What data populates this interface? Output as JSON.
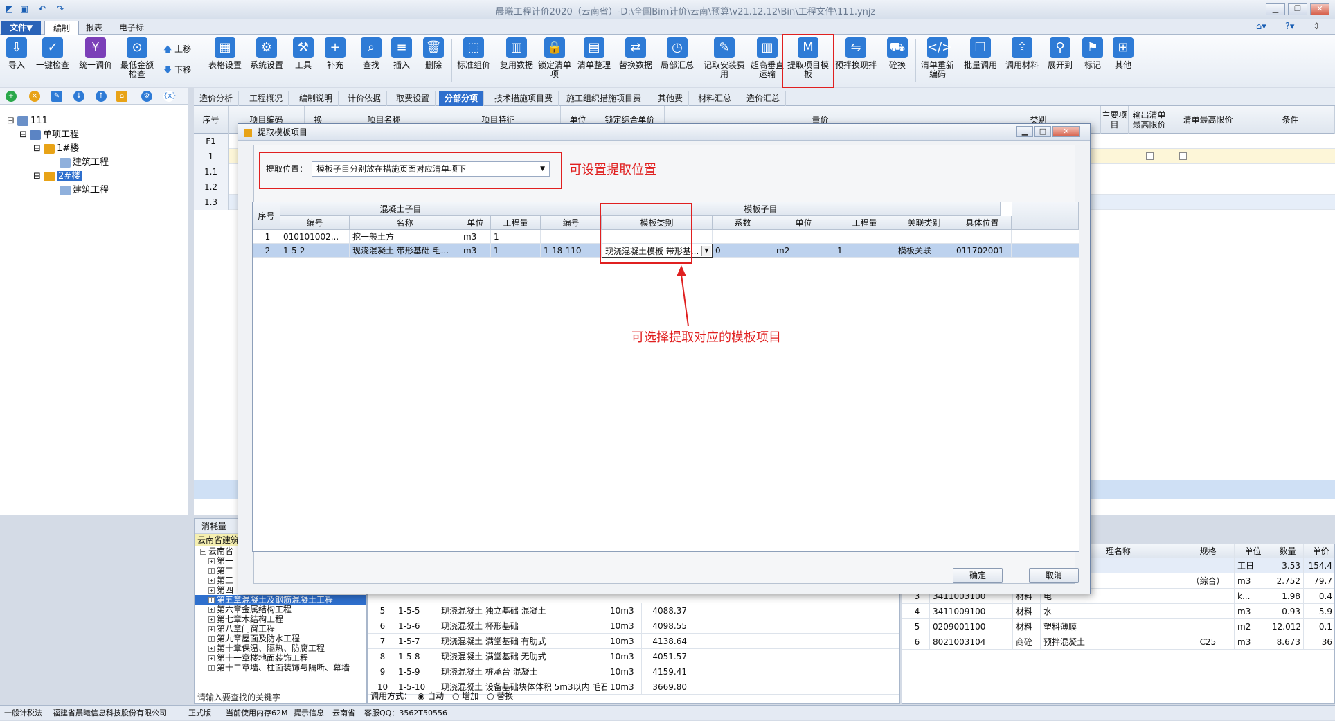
{
  "titlebar": {
    "title": "晨曦工程计价2020（云南省）-D:\\全国Bim计价\\云南\\预算\\v21.12.12\\Bin\\工程文件\\111.ynjz"
  },
  "menubar": {
    "file": "文件▼",
    "tabs": [
      "编制",
      "报表",
      "电子标"
    ]
  },
  "ribbon": {
    "buttons": [
      "导入",
      "一键检查",
      "统一调价",
      "最低金额检查",
      "上移",
      "下移",
      "表格设置",
      "系统设置",
      "工具",
      "补充",
      "查找",
      "插入",
      "删除",
      "标准组价",
      "复用数据",
      "锁定清单项",
      "清单整理",
      "替换数据",
      "局部汇总",
      "记取安装费用",
      "超高垂直运输",
      "提取项目模板",
      "预拌换现拌",
      "砼换",
      "清单重新编码",
      "批量调用",
      "调用材料",
      "展开到",
      "标记",
      "其他"
    ]
  },
  "tree": {
    "root": "111",
    "project": "单项工程",
    "b1": "1#楼",
    "b1c": "建筑工程",
    "b2": "2#楼",
    "b2c": "建筑工程"
  },
  "subtabs": [
    "造价分析",
    "工程概况",
    "编制说明",
    "计价依据",
    "取费设置",
    "分部分项",
    "技术措施项目费",
    "施工组织措施项目费",
    "其他费",
    "材料汇总",
    "造价汇总"
  ],
  "main_headers": [
    "序号",
    "项目编码",
    "换",
    "项目名称",
    "项目特征",
    "单位",
    "锁定综合单价",
    "量价",
    "类别",
    "主要项目",
    "输出清单最高限价",
    "清单最高限价",
    "条件"
  ],
  "main_rows": [
    "F1",
    "1",
    "1.1",
    "1.2",
    "1.3"
  ],
  "bottom_left": {
    "tab": "消耗量",
    "lib": "云南省建筑",
    "root": "云南省",
    "chapters": [
      "第一",
      "第二",
      "第三",
      "第四",
      "第五章混凝土及钢筋混凝土工程",
      "第六章金属结构工程",
      "第七章木结构工程",
      "第八章门窗工程",
      "第九章屋面及防水工程",
      "第十章保温、隔热、防腐工程",
      "第十一章楼地面装饰工程",
      "第十二章墙、柱面装饰与隔断、幕墙"
    ],
    "search_placeholder": "请输入要查找的关键字"
  },
  "bottom_mid": {
    "rows": [
      {
        "n": "5",
        "code": "1-5-5",
        "name": "现浇混凝土 独立基础 混凝土",
        "unit": "10m3",
        "price": "4088.37"
      },
      {
        "n": "6",
        "code": "1-5-6",
        "name": "现浇混凝土 杯形基础",
        "unit": "10m3",
        "price": "4098.55"
      },
      {
        "n": "7",
        "code": "1-5-7",
        "name": "现浇混凝土 满堂基础 有肋式",
        "unit": "10m3",
        "price": "4138.64"
      },
      {
        "n": "8",
        "code": "1-5-8",
        "name": "现浇混凝土 满堂基础 无肋式",
        "unit": "10m3",
        "price": "4051.57"
      },
      {
        "n": "9",
        "code": "1-5-9",
        "name": "现浇混凝土 桩承台 混凝土",
        "unit": "10m3",
        "price": "4159.41"
      },
      {
        "n": "10",
        "code": "1-5-10",
        "name": "现浇混凝土 设备基础块体体积 5m3以内 毛石混凝土",
        "unit": "10m3",
        "price": "3669.80"
      }
    ],
    "call_mode_label": "调用方式：",
    "modes": [
      "自动",
      "增加",
      "替换"
    ]
  },
  "bottom_right": {
    "headers": [
      "",
      "",
      "",
      "理名称",
      "规格",
      "单位",
      "数量",
      "单价"
    ],
    "rows": [
      {
        "n": "",
        "code": "",
        "type": "",
        "name": "2",
        "spec": "",
        "unit": "工日",
        "qty": "3.53",
        "price": "154.4"
      },
      {
        "n": "",
        "code": "",
        "type": "",
        "name": "",
        "spec": "（综合）",
        "unit": "m3",
        "qty": "2.752",
        "price": "79.7"
      },
      {
        "n": "3",
        "code": "3411003100",
        "type": "材料",
        "name": "电",
        "spec": "",
        "unit": "k...",
        "qty": "1.98",
        "price": "0.4"
      },
      {
        "n": "4",
        "code": "3411009100",
        "type": "材料",
        "name": "水",
        "spec": "",
        "unit": "m3",
        "qty": "0.93",
        "price": "5.9"
      },
      {
        "n": "5",
        "code": "0209001100",
        "type": "材料",
        "name": "塑料薄膜",
        "spec": "",
        "unit": "m2",
        "qty": "12.012",
        "price": "0.1"
      },
      {
        "n": "6",
        "code": "8021003104",
        "type": "商砼",
        "name": "预拌混凝土",
        "spec": "C25",
        "unit": "m3",
        "qty": "8.673",
        "price": "36"
      }
    ]
  },
  "status": {
    "items": [
      "一般计税法",
      "福建省晨曦信息科技股份有限公司",
      "正式版",
      "当前使用内存62M",
      "提示信息",
      "云南省",
      "客服QQ：3562T50556"
    ]
  },
  "dialog": {
    "title": "提取模板项目",
    "loc_label": "提取位置：",
    "loc_value": "模板子目分别放在措施页面对应清单项下",
    "ann_loc": "可设置提取位置",
    "ann_type": "可选择提取对应的模板项目",
    "group1": "混凝土子目",
    "group2": "模板子目",
    "headers": [
      "序号",
      "编号",
      "名称",
      "单位",
      "工程量",
      "编号",
      "模板类别",
      "系数",
      "单位",
      "工程量",
      "关联类别",
      "具体位置"
    ],
    "rows": [
      {
        "seq": "1",
        "code": "010101002...",
        "name": "挖一般土方",
        "unit": "m3",
        "qty": "1",
        "mcode": "",
        "mtype": "",
        "coef": "",
        "munit": "",
        "mqty": "",
        "rel": "",
        "pos": ""
      },
      {
        "seq": "2",
        "code": "1-5-2",
        "name": "现浇混凝土 带形基础 毛...",
        "unit": "m3",
        "qty": "1",
        "mcode": "1-18-110",
        "mtype": "现浇混凝土模板 带形基...",
        "coef": "0",
        "munit": "m2",
        "mqty": "1",
        "rel": "模板关联",
        "pos": "011702001"
      }
    ],
    "ok": "确定",
    "cancel": "取消"
  }
}
